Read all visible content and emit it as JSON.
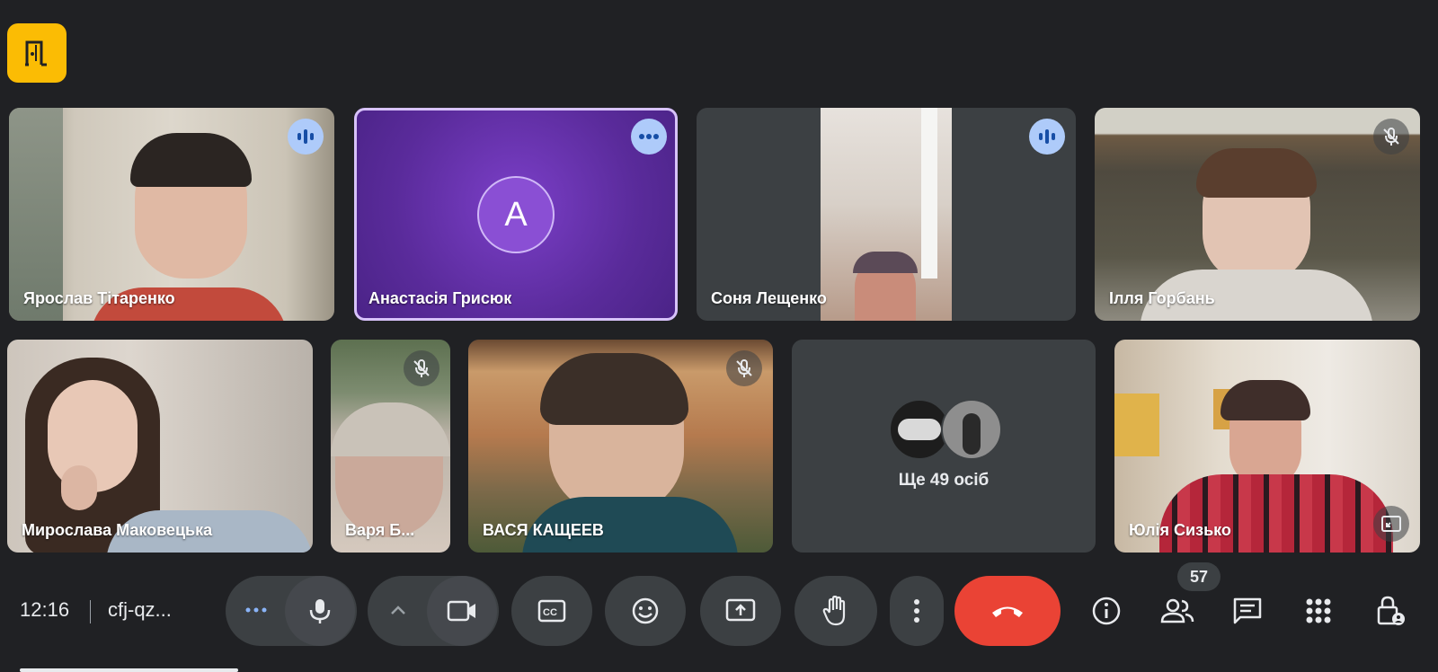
{
  "participants": [
    {
      "name": "Ярослав Тітаренко",
      "status": "speaking"
    },
    {
      "name": "Анастасія Грисюк",
      "avatar_letter": "А",
      "status": "more-options"
    },
    {
      "name": "Соня Лещенко",
      "status": "speaking"
    },
    {
      "name": "Ілля Горбань",
      "status": "muted"
    },
    {
      "name": "Мирослава Маковецька",
      "status": "none"
    },
    {
      "name": "Варя Б...",
      "status": "muted"
    },
    {
      "name": "ВАСЯ КАЩЕЕВ",
      "status": "muted"
    },
    {
      "name": "Юлія Сизько",
      "status": "pinned-view"
    }
  ],
  "others": {
    "label": "Ще 49 осіб"
  },
  "controls": {
    "time": "12:16",
    "meeting_code": "cfj-qz...",
    "participant_count": "57"
  },
  "colors": {
    "background": "#202124",
    "tile": "#3c4043",
    "accent_purple": "#6a32b5",
    "speaking_badge": "#aecbfa",
    "end_call": "#ea4335",
    "breakout": "#fbbc04"
  },
  "icons": [
    "door-icon",
    "speaking-icon",
    "more-dots-icon",
    "mic-off-icon",
    "fullscreen-icon",
    "mic-icon",
    "camera-icon",
    "captions-icon",
    "emoji-icon",
    "present-icon",
    "hand-icon",
    "more-vert-icon",
    "hangup-icon",
    "info-icon",
    "people-icon",
    "chat-icon",
    "apps-icon",
    "host-controls-icon"
  ]
}
